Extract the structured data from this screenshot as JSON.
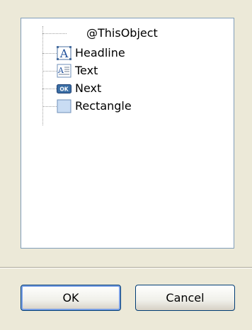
{
  "tree": {
    "root_label": "@ThisObject",
    "items": [
      {
        "label": "Headline",
        "icon": "headline-icon"
      },
      {
        "label": "Text",
        "icon": "text-icon"
      },
      {
        "label": "Next",
        "icon": "ok-button-icon",
        "icon_text": "OK"
      },
      {
        "label": "Rectangle",
        "icon": "rectangle-icon"
      }
    ]
  },
  "buttons": {
    "ok_label": "OK",
    "cancel_label": "Cancel"
  },
  "colors": {
    "dialog_background": "#ece9d8",
    "panel_border": "#7f9db9",
    "button_border": "#003c74",
    "icon_blue": "#3a6ea5",
    "rectangle_fill": "#c9dcf3"
  }
}
